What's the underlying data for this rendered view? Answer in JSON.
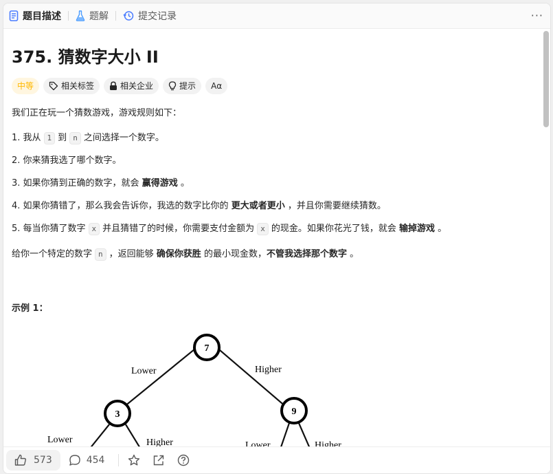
{
  "tabs": {
    "description": "题目描述",
    "solution": "题解",
    "submissions": "提交记录"
  },
  "more_label": "···",
  "problem": {
    "title": "375. 猜数字大小 II",
    "tags": {
      "difficulty": "中等",
      "topics": "相关标签",
      "companies": "相关企业",
      "hint": "提示",
      "font": "Aα"
    },
    "intro": "我们正在玩一个猜数游戏，游戏规则如下：",
    "rule1": {
      "a": "1. 我从",
      "code1": "1",
      "b": "到",
      "code2": "n",
      "c": "之间选择一个数字。"
    },
    "rule2": "2. 你来猜我选了哪个数字。",
    "rule3": {
      "a": "3. 如果你猜到正确的数字，就会",
      "bold": "赢得游戏",
      "c": "。"
    },
    "rule4": {
      "a": "4. 如果你猜错了，那么我会告诉你，我选的数字比你的",
      "bold": "更大或者更小",
      "c": "，并且你需要继续猜数。"
    },
    "rule5": {
      "a": "5. 每当你猜了数字",
      "code1": "x",
      "b": "并且猜错了的时候，你需要支付金额为",
      "code2": "x",
      "c": "的现金。如果你花光了钱，就会",
      "bold": "输掉游戏",
      "d": "。"
    },
    "task": {
      "a": "给你一个特定的数字",
      "code": "n",
      "b": "，返回能够",
      "bold1": "确保你获胜",
      "c": "的最小现金数，",
      "bold2": "不管我选择那个数字",
      "d": "。"
    },
    "example_title": "示例 1："
  },
  "tree": {
    "root": "7",
    "left": "3",
    "right": "9",
    "lower_root": "Lower",
    "higher_root": "Higher",
    "lower_left": "Lower",
    "higher_left": "Higher",
    "lower_right": "Lower",
    "higher_right": "Higher"
  },
  "bottom": {
    "likes": "573",
    "comments": "454"
  },
  "colors": {
    "difficulty": "#ffb800",
    "tab_icon_blue": "#4a7cff",
    "text": "#262626"
  }
}
